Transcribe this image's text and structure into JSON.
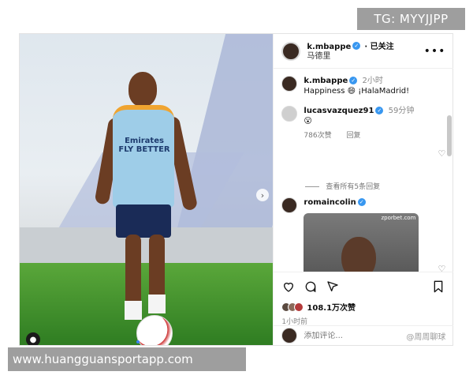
{
  "watermark_top": "TG: MYYJJPP",
  "watermark_bottom": "www.huangguansportapp.com",
  "photo": {
    "jersey_text": "Emirates\nFLY BETTER"
  },
  "post_header": {
    "username": "k.mbappe",
    "follow_status": "· 已关注",
    "location": "马德里",
    "more_icon": "more-horizontal-icon"
  },
  "comments": [
    {
      "username": "k.mbappe",
      "time": "2小时",
      "text": "Happiness 😄 ¡HalaMadrid!"
    },
    {
      "username": "lucasvazquez91",
      "time": "59分钟",
      "text": "😮",
      "likes": "786次赞",
      "reply": "回复",
      "view_replies": "查看所有5条回复"
    },
    {
      "username": "romaincolin",
      "gif_label": "zporbet.com"
    }
  ],
  "actions": {
    "likes": "108.1万次赞",
    "time_ago": "1小时前"
  },
  "add_comment": {
    "placeholder": "添加评论...",
    "brand": "@周周聊球"
  },
  "colors": {
    "verified": "#3897f0",
    "watermark_bg": "#9e9e9e"
  }
}
